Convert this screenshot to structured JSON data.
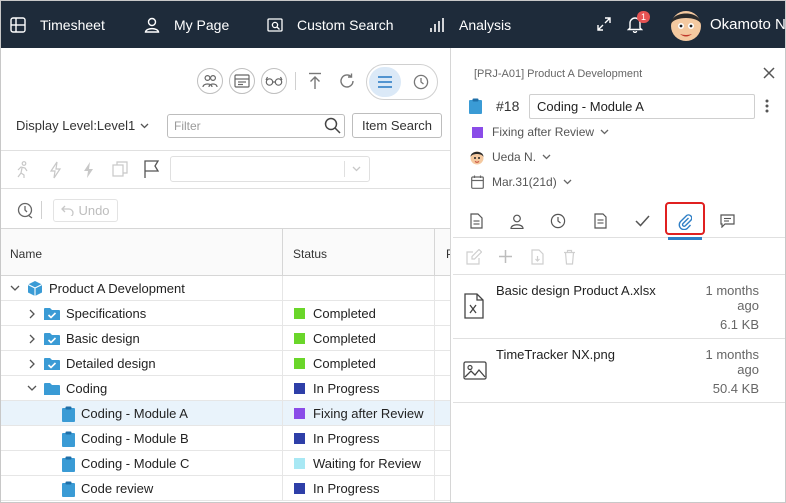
{
  "topnav": {
    "timesheet": "Timesheet",
    "my_page": "My Page",
    "custom_search": "Custom Search",
    "analysis": "Analysis",
    "notification_count": "1",
    "username": "Okamoto N"
  },
  "toolbar": {
    "display_level": "Display Level:Level1",
    "filter_placeholder": "Filter",
    "item_search": "Item Search",
    "undo": "Undo"
  },
  "grid": {
    "columns": {
      "name": "Name",
      "status": "Status",
      "extra": "P"
    },
    "rows": [
      {
        "name": "Product A Development",
        "status": "",
        "status_color": ""
      },
      {
        "name": "Specifications",
        "status": "Completed",
        "status_color": "#6ad62a"
      },
      {
        "name": "Basic design",
        "status": "Completed",
        "status_color": "#6ad62a"
      },
      {
        "name": "Detailed design",
        "status": "Completed",
        "status_color": "#6ad62a"
      },
      {
        "name": "Coding",
        "status": "In Progress",
        "status_color": "#2e3fa8"
      },
      {
        "name": "Coding - Module A",
        "status": "Fixing after Review",
        "status_color": "#8a4ce8"
      },
      {
        "name": "Coding - Module B",
        "status": "In Progress",
        "status_color": "#2e3fa8"
      },
      {
        "name": "Coding - Module C",
        "status": "Waiting for Review",
        "status_color": "#a8e8f4"
      },
      {
        "name": "Code review",
        "status": "In Progress",
        "status_color": "#2e3fa8"
      }
    ]
  },
  "detail": {
    "breadcrumb": "[PRJ-A01] Product A Development",
    "id": "#18",
    "title": "Coding - Module A",
    "status": "Fixing after Review",
    "status_color": "#8a4ce8",
    "assignee": "Ueda N.",
    "due": "Mar.31(21d)",
    "files": [
      {
        "name": "Basic design Product A.xlsx",
        "time": "1 months ago",
        "size": "6.1 KB",
        "icon": "excel-file-icon"
      },
      {
        "name": "TimeTracker NX.png",
        "time": "1 months ago",
        "size": "50.4 KB",
        "icon": "image-file-icon"
      }
    ]
  },
  "colors": {
    "nav_bg": "#1e2b3a",
    "accent": "#2f7fc6",
    "folder": "#3a9bd5",
    "highlight": "#e02020"
  }
}
